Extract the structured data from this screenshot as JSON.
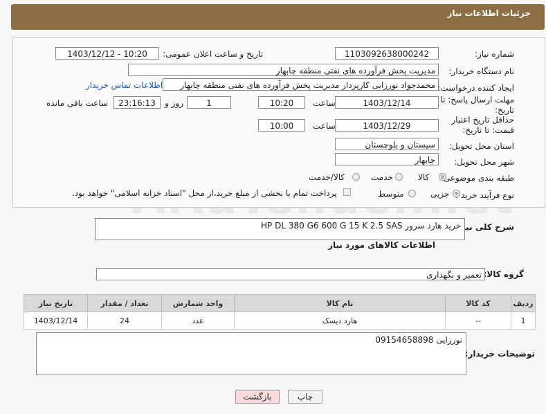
{
  "header": {
    "title": "جزئیات اطلاعات نیاز"
  },
  "watermark": "AriaTender.net",
  "fields": {
    "need_number_label": "شماره نیاز:",
    "need_number": "1103092638000242",
    "announce_label": "تاریخ و ساعت اعلان عمومی:",
    "announce_value": "1403/12/12 - 10:20",
    "buyer_org_label": "نام دستگاه خریدار:",
    "buyer_org": "مدیریت پخش فرآورده های نفتی منطقه چابهار",
    "creator_label": "ایجاد کننده درخواست:",
    "creator": "محمدجواد نورزایی کارپرداز مدیریت پخش فرآورده های نفتی منطقه چابهار",
    "contact_link": "اطلاعات تماس خریدار",
    "reply_deadline_label": "مهلت ارسال پاسخ: تا تاریخ:",
    "reply_date": "1403/12/14",
    "time_label": "ساعت",
    "reply_time": "10:20",
    "days_value": "1",
    "days_label": "روز و",
    "remaining_time": "23:16:13",
    "remaining_label": "ساعت باقی مانده",
    "price_validity_label": "حداقل تاریخ اعتبار قیمت: تا تاریخ:",
    "validity_date": "1403/12/29",
    "validity_time": "10:00",
    "province_label": "استان محل تحویل:",
    "province": "سیستان و بلوچستان",
    "city_label": "شهر محل تحویل:",
    "city": "چابهار",
    "category_label": "طبقه بندی موضوعی:",
    "category_options": [
      "کالا",
      "خدمت",
      "کالا/خدمت"
    ],
    "process_label": "نوع فرآیند خرید :",
    "process_options": [
      "جزیی",
      "متوسط"
    ],
    "payment_note": "پرداخت تمام یا بخشی از مبلغ خرید،از محل \"اسناد خزانه اسلامی\" خواهد بود."
  },
  "summary": {
    "label": "شرح کلی نیاز:",
    "value": "خرید هارد  سرور HP DL 380 G6 600 G 15 K 2.5 SAS"
  },
  "goods_info_title": "اطلاعات کالاهای مورد نیاز",
  "goods_group": {
    "label": "گروه کالا:",
    "value": "تعمیر و نگهداری"
  },
  "table": {
    "headers": [
      "ردیف",
      "کد کالا",
      "نام کالا",
      "واحد شمارش",
      "تعداد / مقدار",
      "تاریخ نیاز"
    ],
    "rows": [
      [
        "1",
        "--",
        "هارد دیسک",
        "عدد",
        "24",
        "1403/12/14"
      ]
    ]
  },
  "buyer_notes": {
    "label": "توضیحات خریدار:",
    "value": "نورزایی 09154658898"
  },
  "buttons": {
    "print": "چاپ",
    "back": "بازگشت"
  },
  "colors": {
    "header": "#8b6f43",
    "back_button": "#f9d9d9"
  }
}
